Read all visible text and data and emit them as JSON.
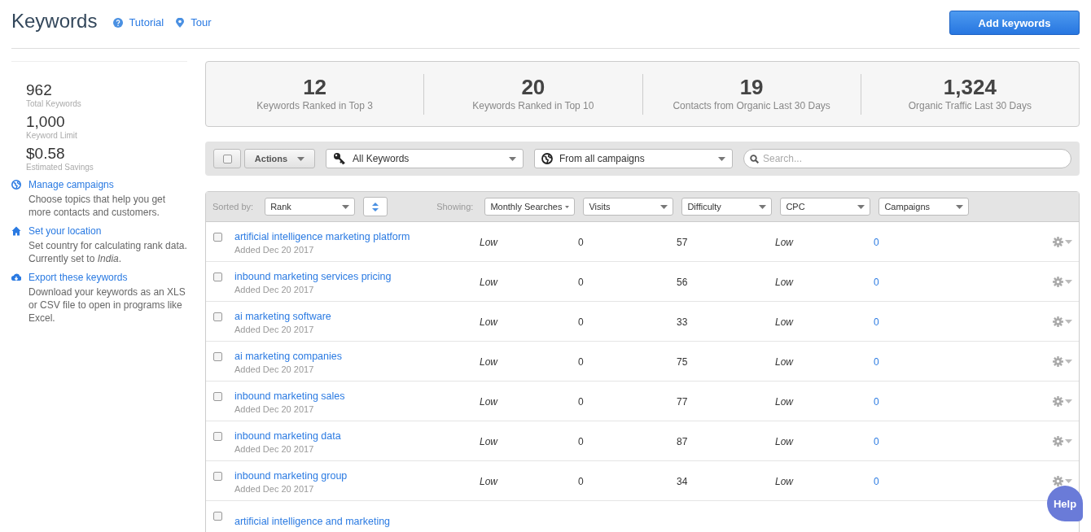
{
  "header": {
    "title": "Keywords",
    "links": [
      {
        "kind": "tutorial",
        "label": "Tutorial"
      },
      {
        "kind": "tour",
        "label": "Tour"
      }
    ],
    "button": "Add keywords"
  },
  "sidebar": {
    "stats": [
      {
        "value": "962",
        "label": "Total Keywords"
      },
      {
        "value": "1,000",
        "label": "Keyword Limit"
      },
      {
        "value": "$0.58",
        "label": "Estimated Savings"
      }
    ],
    "actions": [
      {
        "kind": "globe",
        "label": "Manage campaigns",
        "description": "Choose topics that help you get more contacts and customers."
      },
      {
        "kind": "home",
        "label": "Set your location",
        "description": "Set country for calculating rank data. Currently set to *India*."
      },
      {
        "kind": "cloud",
        "label": "Export these keywords",
        "description": "Download your keywords as an XLS or CSV file to open in programs like Excel."
      }
    ]
  },
  "summary": [
    {
      "value": "12",
      "label": "Keywords Ranked in Top 3"
    },
    {
      "value": "20",
      "label": "Keywords Ranked in Top 10"
    },
    {
      "value": "19",
      "label": "Contacts from Organic Last 30 Days"
    },
    {
      "value": "1,324",
      "label": "Organic Traffic Last 30 Days"
    }
  ],
  "toolbar": {
    "select_all_checked": false,
    "actions": "Actions",
    "filter": "All Keywords",
    "campaigns": "From all campaigns",
    "search": {
      "placeholder": "Search..."
    }
  },
  "table": {
    "sorted_by_label": "Sorted by:",
    "sort": "Rank",
    "showing_label": "Showing:",
    "columns": [
      "Monthly Searches",
      "Visits",
      "Difficulty",
      "CPC",
      "Campaigns"
    ],
    "rows": [
      {
        "keyword": "artificial intelligence marketing platform",
        "added": "Added Dec 20 2017",
        "cells": [
          "Low",
          "0",
          "57",
          "Low",
          "0"
        ],
        "checked": false
      },
      {
        "keyword": "inbound marketing services pricing",
        "added": "Added Dec 20 2017",
        "cells": [
          "Low",
          "0",
          "56",
          "Low",
          "0"
        ],
        "checked": false
      },
      {
        "keyword": "ai marketing software",
        "added": "Added Dec 20 2017",
        "cells": [
          "Low",
          "0",
          "33",
          "Low",
          "0"
        ],
        "checked": false
      },
      {
        "keyword": "ai marketing companies",
        "added": "Added Dec 20 2017",
        "cells": [
          "Low",
          "0",
          "75",
          "Low",
          "0"
        ],
        "checked": false
      },
      {
        "keyword": "inbound marketing sales",
        "added": "Added Dec 20 2017",
        "cells": [
          "Low",
          "0",
          "77",
          "Low",
          "0"
        ],
        "checked": false
      },
      {
        "keyword": "inbound marketing data",
        "added": "Added Dec 20 2017",
        "cells": [
          "Low",
          "0",
          "87",
          "Low",
          "0"
        ],
        "checked": false
      },
      {
        "keyword": "inbound marketing group",
        "added": "Added Dec 20 2017",
        "cells": [
          "Low",
          "0",
          "34",
          "Low",
          "0"
        ],
        "checked": false
      },
      {
        "keyword": "artificial intelligence and marketing",
        "checked": false
      }
    ]
  },
  "help": "Help"
}
